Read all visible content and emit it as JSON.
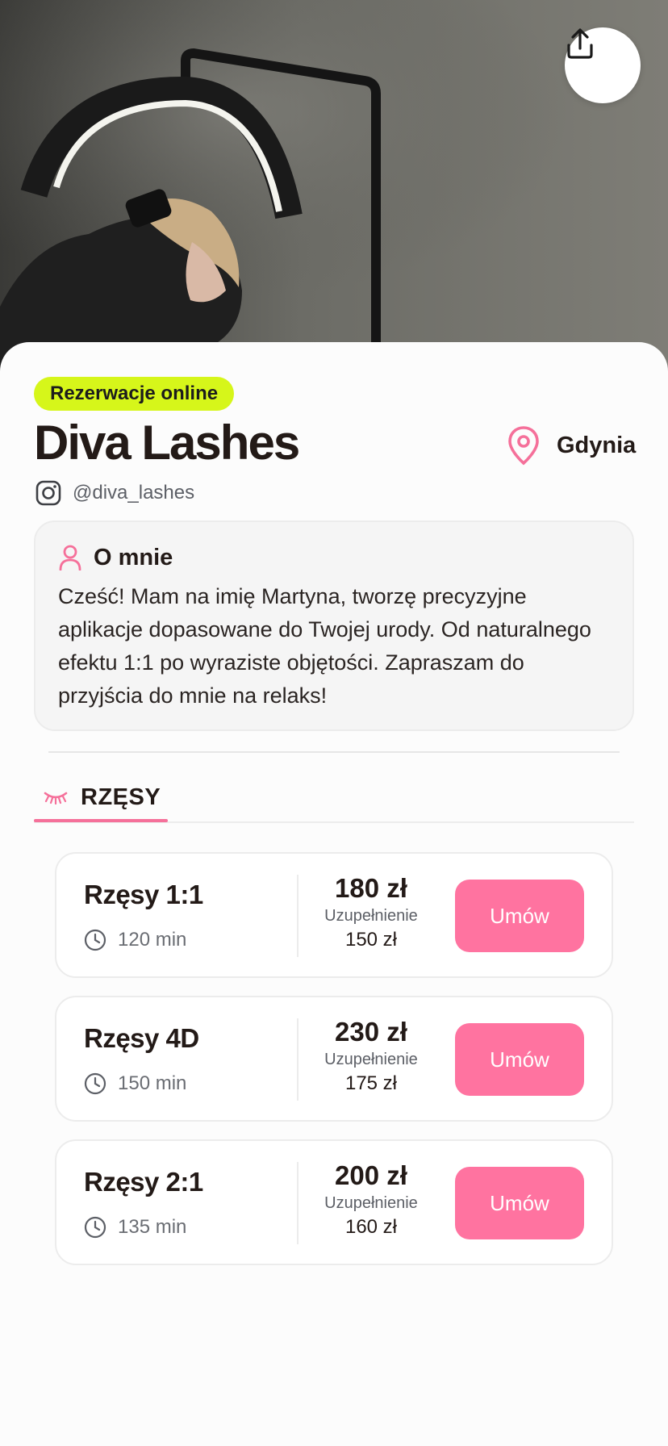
{
  "header": {
    "share_icon": "share-icon"
  },
  "profile": {
    "badge": "Rezerwacje online",
    "name": "Diva Lashes",
    "city": "Gdynia",
    "instagram": "@diva_lashes",
    "accent_color": "#ff73a0",
    "badge_color": "#d6f61a"
  },
  "about": {
    "title": "O mnie",
    "text": "Cześć! Mam na imię Martyna, tworzę precyzyjne aplikacje dopasowane do Twojej urody. Od naturalnego efektu 1:1 po wyraziste objętości. Zapraszam do przyjścia do mnie na relaks!"
  },
  "tabs": [
    {
      "label": "RZĘSY",
      "icon": "lashes-icon",
      "active": true
    }
  ],
  "services": [
    {
      "name": "Rzęsy 1:1",
      "duration": "120 min",
      "price": "180 zł",
      "refill_label": "Uzupełnienie",
      "refill_price": "150 zł",
      "button": "Umów"
    },
    {
      "name": "Rzęsy 4D",
      "duration": "150 min",
      "price": "230 zł",
      "refill_label": "Uzupełnienie",
      "refill_price": "175 zł",
      "button": "Umów"
    },
    {
      "name": "Rzęsy 2:1",
      "duration": "135 min",
      "price": "200 zł",
      "refill_label": "Uzupełnienie",
      "refill_price": "160 zł",
      "button": "Umów"
    }
  ]
}
